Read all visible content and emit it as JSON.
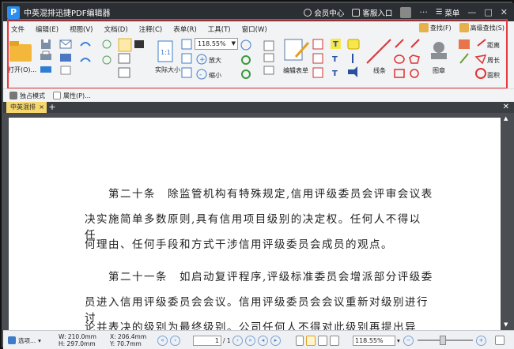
{
  "titlebar": {
    "logo": "P",
    "title": "中英混排迅捷PDF编辑器",
    "member": "会员中心",
    "service": "客服入口",
    "menu": "菜单",
    "minimize": "—",
    "maximize": "□",
    "close": "✕"
  },
  "menubar": {
    "items": [
      "文件",
      "编辑(E)",
      "视图(V)",
      "文档(D)",
      "注释(C)",
      "表单(R)",
      "工具(T)",
      "窗口(W)"
    ],
    "find": "查找(F)",
    "advanced_find": "高级查找(S)"
  },
  "toolbar": {
    "open_label": "打开(O)...",
    "actual_size": "实际大小",
    "zoom_value": "118.55%",
    "zoom_in": "放大",
    "zoom_out": "缩小",
    "edit_form": "编辑表单",
    "lines": "线条",
    "stamp": "图章",
    "distance": "距离",
    "perimeter": "周长",
    "area": "面积"
  },
  "subbar": {
    "exclusive_mode": "独占模式",
    "properties": "属性(P)..."
  },
  "tabs": {
    "doc_tab": "中英混排",
    "close": "×",
    "add": "+",
    "close_all": "✕"
  },
  "document": {
    "paragraphs": [
      "第二十条　除监管机构有特殊规定,信用评级委员会评审会议表",
      "决实施简单多数原则,具有信用项目级别的决定权。任何人不得以任",
      "何理由、任何手段和方式干涉信用评级委员会成员的观点。",
      "第二十一条　如启动复评程序,评级标准委员会增派部分评级委",
      "员进入信用评级委员会会议。信用评级委员会会议重新对级别进行讨",
      "论并表决的级别为最终级别。公司任何人不得对此级别再提出异议。"
    ]
  },
  "statusbar": {
    "options": "选项...",
    "width": "W: 210.0mm",
    "height": "H: 297.0mm",
    "x": "X: 206.4mm",
    "y": "Y: 70.7mm",
    "page_input": "1",
    "page_total": "/ 1",
    "zoom": "118.55%"
  },
  "colors": {
    "highlight": "#e8393f",
    "titlebar_bg": "#2b2e33",
    "tab_active": "#f5d76e",
    "arrow": "#e8393f"
  }
}
